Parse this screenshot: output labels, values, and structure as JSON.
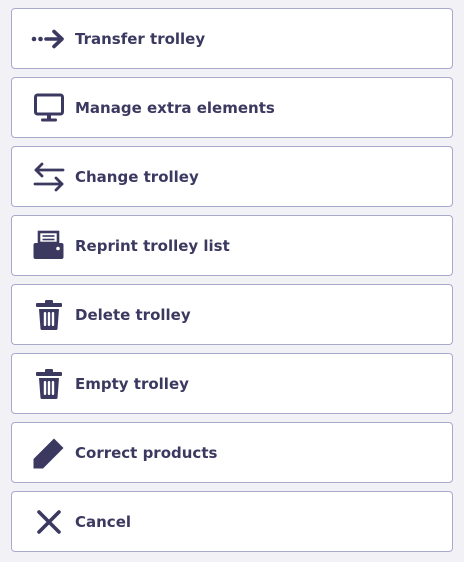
{
  "menu": {
    "items": [
      {
        "label": "Transfer trolley",
        "icon": "arrow-right-icon"
      },
      {
        "label": "Manage extra elements",
        "icon": "monitor-icon"
      },
      {
        "label": "Change trolley",
        "icon": "swap-arrows-icon"
      },
      {
        "label": "Reprint trolley list",
        "icon": "printer-icon"
      },
      {
        "label": "Delete trolley",
        "icon": "trash-icon"
      },
      {
        "label": "Empty trolley",
        "icon": "trash-icon"
      },
      {
        "label": "Correct products",
        "icon": "pencil-icon"
      },
      {
        "label": "Cancel",
        "icon": "close-icon"
      }
    ]
  },
  "colors": {
    "icon": "#3b3960",
    "text": "#3b3960",
    "border": "#a9a9cc",
    "background": "#f1f1f6",
    "item_background": "#ffffff"
  }
}
